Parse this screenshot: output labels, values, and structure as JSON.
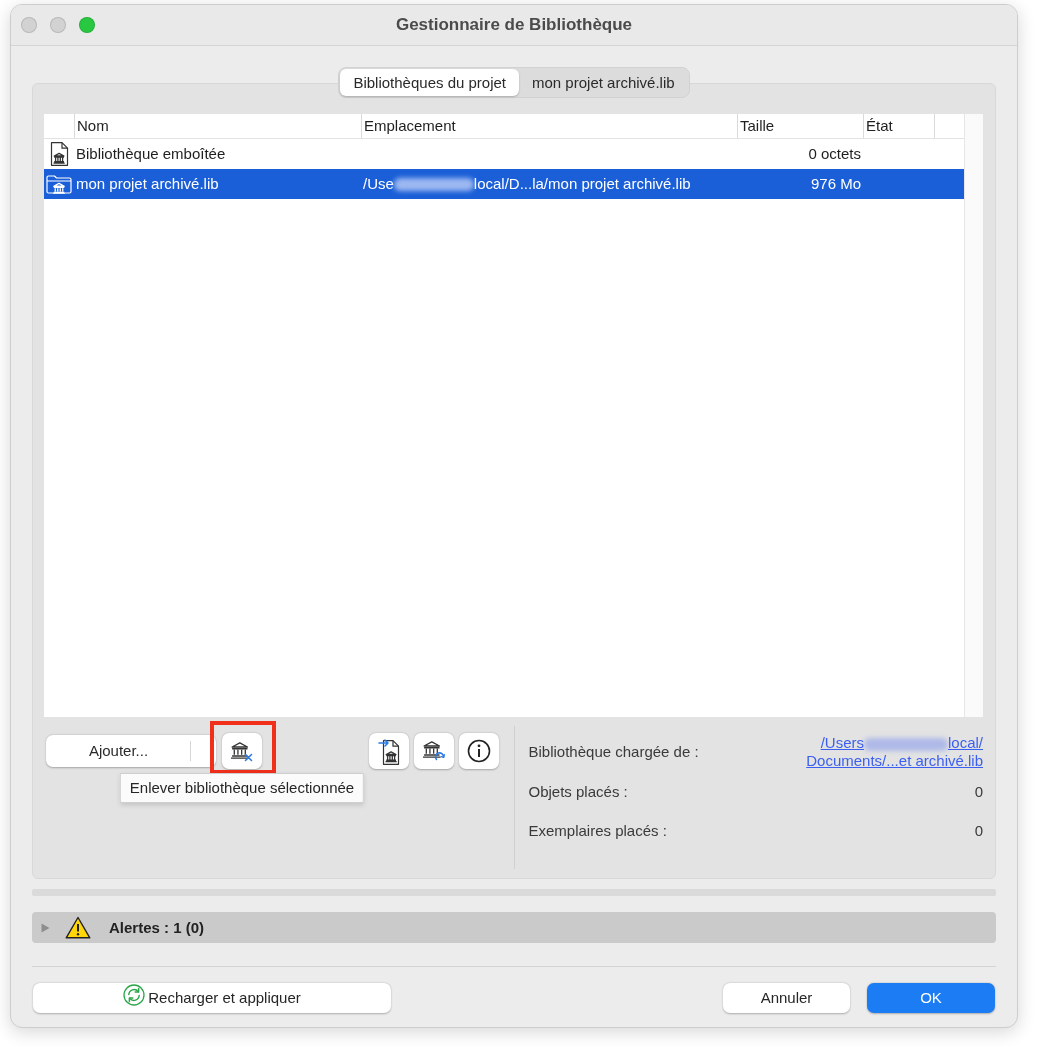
{
  "window": {
    "title": "Gestionnaire de Bibliothèque",
    "controls": [
      {
        "kind": "close",
        "enabled": false
      },
      {
        "kind": "minimize",
        "enabled": false
      },
      {
        "kind": "zoom",
        "enabled": true
      }
    ]
  },
  "tabs": [
    {
      "label": "Bibliothèques du projet",
      "selected": true
    },
    {
      "label": "mon projet archivé.lib",
      "selected": false
    }
  ],
  "table": {
    "columns": [
      "Nom",
      "Emplacement",
      "Taille",
      "État"
    ],
    "rows": [
      {
        "kind": "document",
        "name": "Bibliothèque emboîtée",
        "size": "0 octets",
        "selected": false
      },
      {
        "kind": "folder",
        "name": "mon projet archivé.lib",
        "location": [
          "/Use",
          "local/D...la/mon projet archivé.lib"
        ],
        "size": "976 Mo",
        "selected": true
      }
    ]
  },
  "toolbar": {
    "add_button": "Ajouter...",
    "left_buttons": [
      {
        "kind": "remove",
        "highlighted": true,
        "tooltip": "Enlever bibliothèque sélectionnée"
      }
    ],
    "right_buttons": [
      {
        "kind": "import",
        "highlighted": false
      },
      {
        "kind": "reload",
        "highlighted": false
      },
      {
        "kind": "info",
        "highlighted": false
      }
    ]
  },
  "details": [
    {
      "kind": "link",
      "label": "Bibliothèque chargée de :",
      "link_lines": [
        [
          "/Users",
          "local/"
        ],
        [
          "Documents/...et archivé.lib"
        ]
      ]
    },
    {
      "kind": "value",
      "label": "Objets placés :",
      "value": "0"
    },
    {
      "kind": "value",
      "label": "Exemplaires placés :",
      "value": "0"
    }
  ],
  "alerts": {
    "label": "Alertes : 1 (0)",
    "expanded": false
  },
  "footer_buttons": [
    {
      "kind": "reload",
      "label": "Recharger et appliquer"
    },
    {
      "kind": "cancel",
      "label": "Annuler"
    },
    {
      "kind": "default",
      "label": "OK"
    }
  ]
}
